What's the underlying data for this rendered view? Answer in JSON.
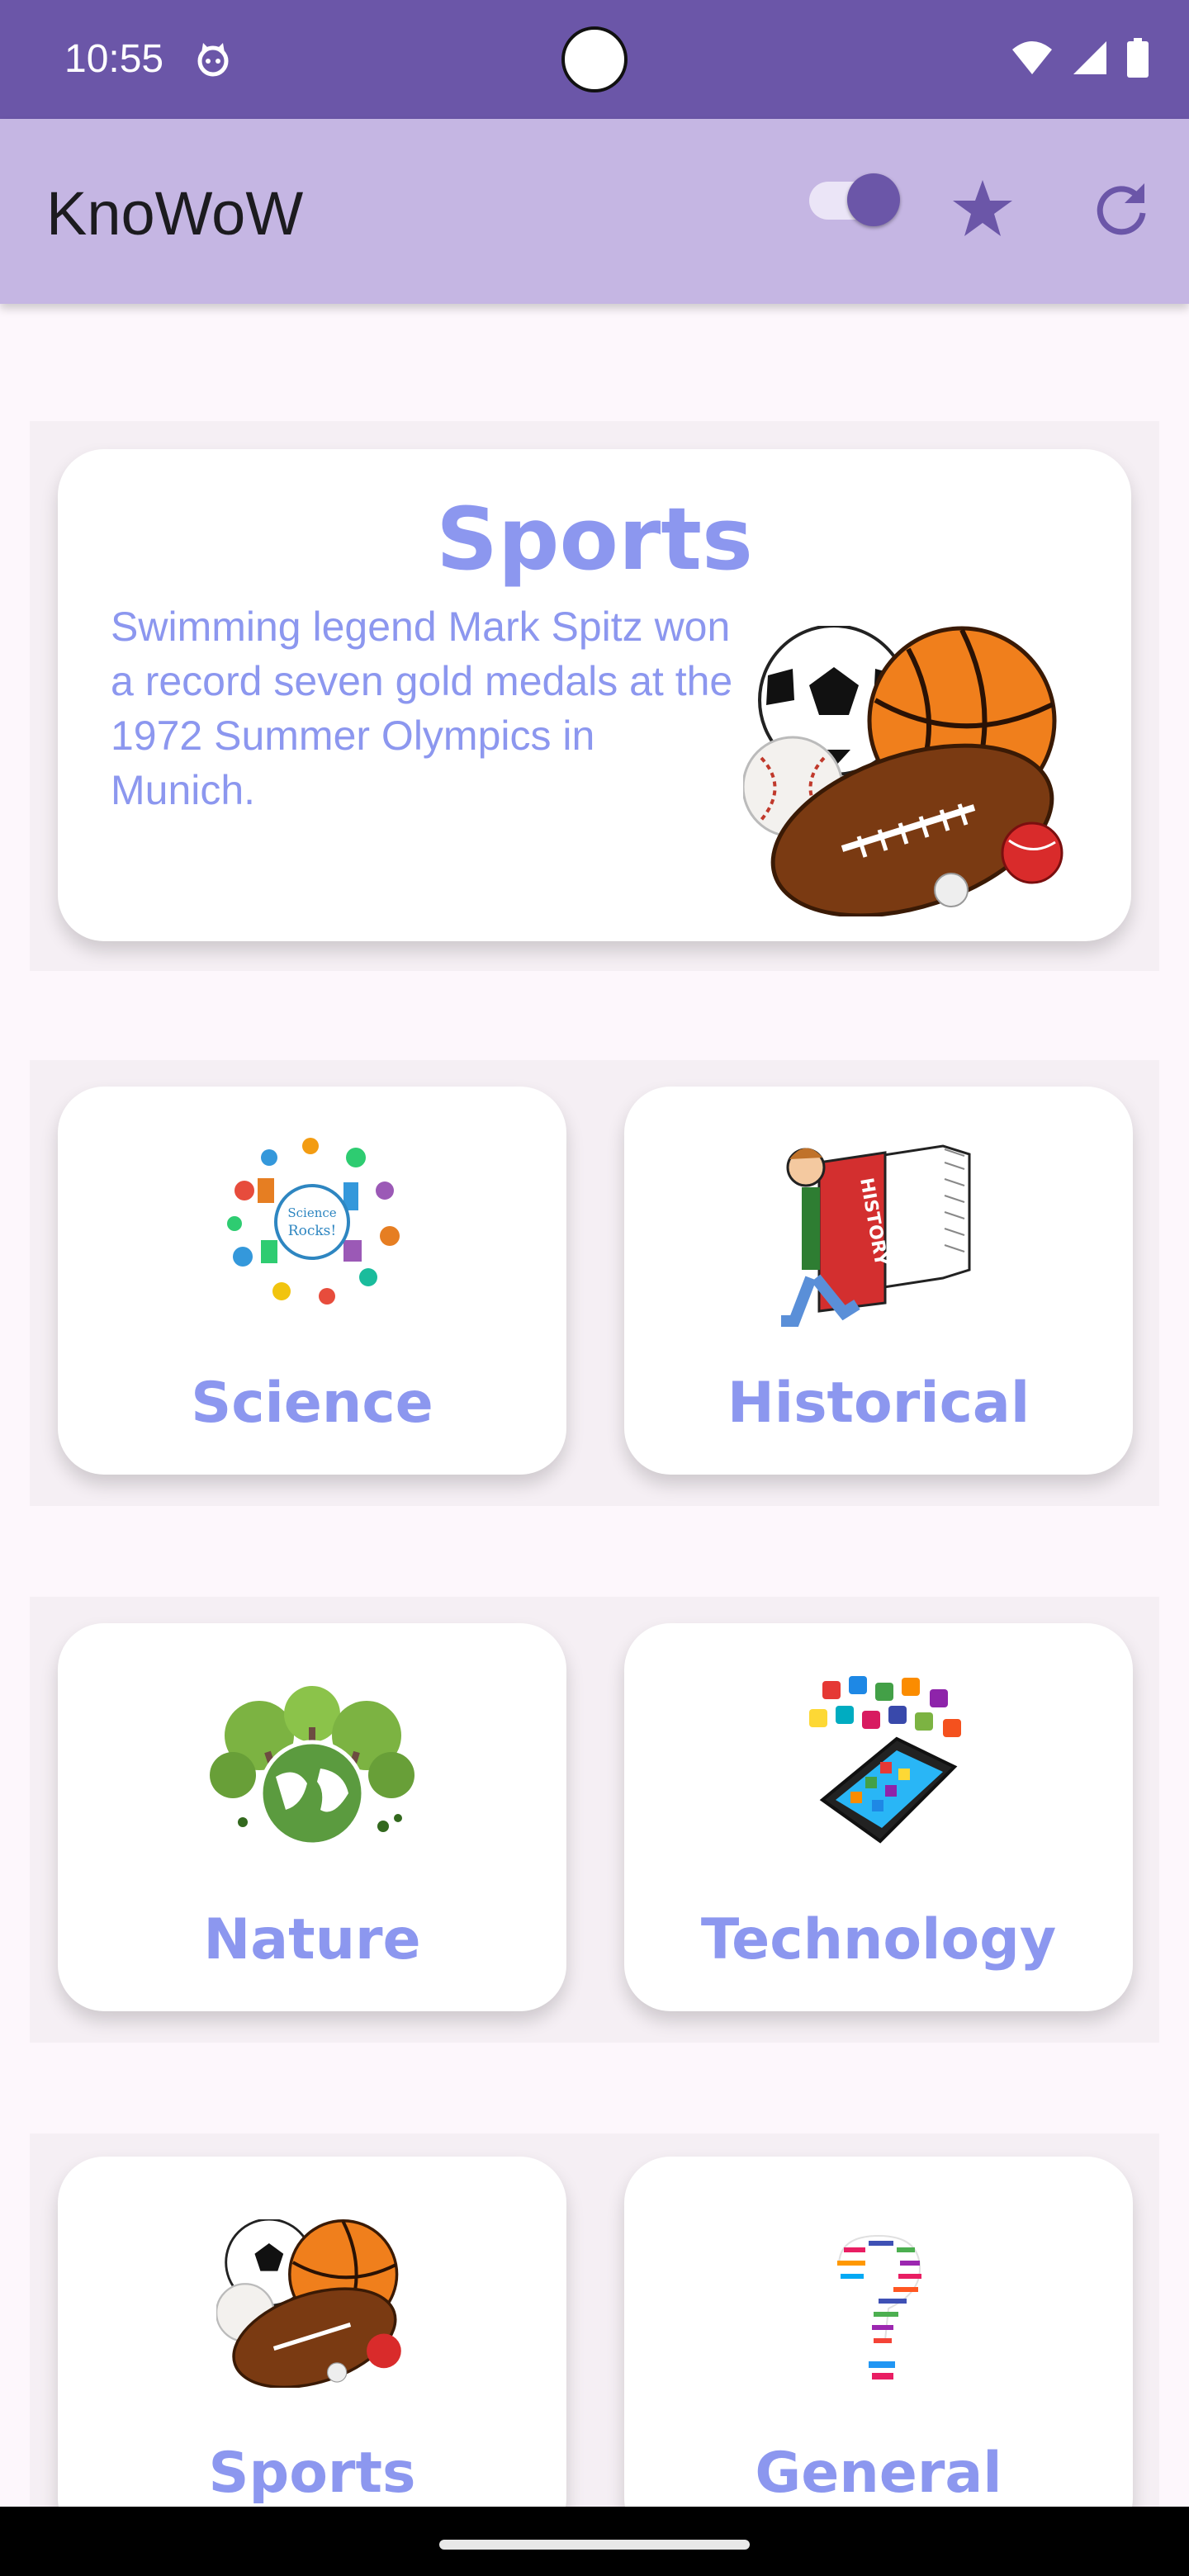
{
  "status": {
    "time": "10:55"
  },
  "app": {
    "title": "KnoWoW"
  },
  "toolbar": {
    "toggle_on": true
  },
  "featured": {
    "title": "Sports",
    "fact": "Swimming legend Mark Spitz won a record seven gold medals at the 1972 Summer Olympics in Munich."
  },
  "categories": [
    {
      "label": "Science"
    },
    {
      "label": "Historical"
    },
    {
      "label": "Nature"
    },
    {
      "label": "Technology"
    },
    {
      "label": "Sports"
    },
    {
      "label": "General"
    }
  ],
  "colors": {
    "primary": "#6b56a8",
    "appbar": "#c5b6e3",
    "accent_text": "#8c97ef",
    "background": "#fdf7fc"
  }
}
